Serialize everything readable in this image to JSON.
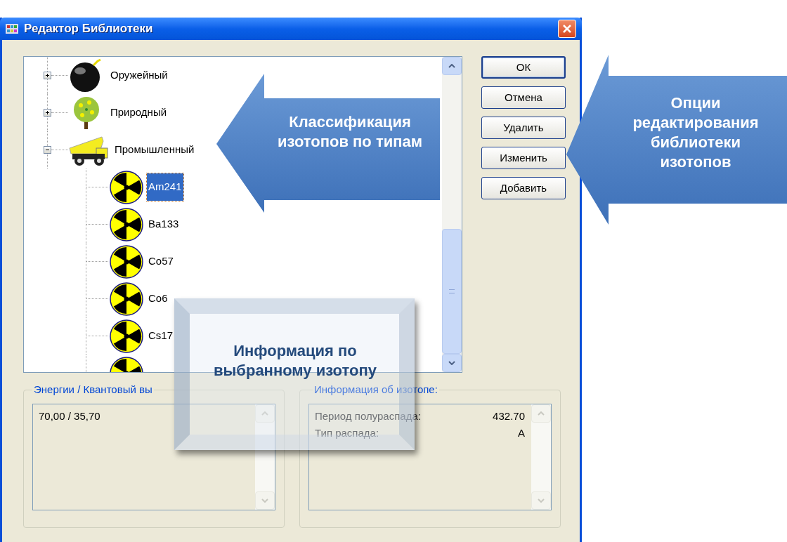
{
  "window": {
    "title": "Редактор Библиотеки"
  },
  "tree": {
    "items": [
      {
        "label": "Оружейный",
        "kind": "bomb",
        "expanded": false
      },
      {
        "label": "Природный",
        "kind": "tree",
        "expanded": false
      },
      {
        "label": "Промышленный",
        "kind": "truck",
        "expanded": true,
        "children": [
          {
            "label": "Am241",
            "kind": "isotope",
            "selected": true
          },
          {
            "label": "Ba133",
            "kind": "isotope",
            "selected": false
          },
          {
            "label": "Co57",
            "kind": "isotope",
            "selected": false
          },
          {
            "label": "Co6",
            "kind": "isotope",
            "selected": false
          },
          {
            "label": "Cs17",
            "kind": "isotope",
            "selected": false
          },
          {
            "kind": "isotope"
          }
        ]
      }
    ]
  },
  "buttons": [
    "ОК",
    "Отмена",
    "Удалить",
    "Изменить",
    "Добавить"
  ],
  "energy_group": {
    "title": "Энергии / Квантовый вы",
    "lines": [
      "70,00 / 35,70"
    ]
  },
  "info_group": {
    "title": "Информация об изотопе:",
    "rows": [
      {
        "label": "Период полураспада:",
        "value": "432.70"
      },
      {
        "label": "Тип распада:",
        "value": "A"
      }
    ]
  },
  "callouts": [
    {
      "kind": "arrow",
      "text": "Классификация изотопов по типам"
    },
    {
      "kind": "arrow",
      "text": "Опции редактирования библиотеки изотопов"
    },
    {
      "kind": "box",
      "text": "Информация по выбранному изотопу"
    }
  ]
}
